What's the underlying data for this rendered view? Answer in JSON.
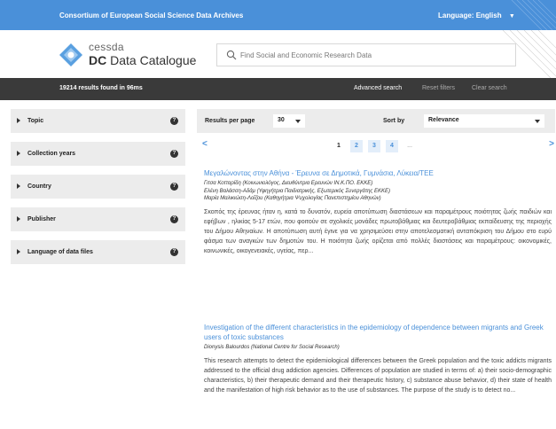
{
  "topbar": {
    "org": "Consortium of European Social Science Data Archives",
    "language_label": "Language:",
    "language_value": "English"
  },
  "logo": {
    "cessda": "cessda",
    "dc": "DC",
    "catalogue": " Data Catalogue"
  },
  "search": {
    "placeholder": "Find Social and Economic Research Data"
  },
  "resultsbar": {
    "count": "19214 results found in 96ms",
    "advanced": "Advanced search",
    "reset": "Reset filters",
    "clear": "Clear search"
  },
  "facets": [
    {
      "label": "Topic"
    },
    {
      "label": "Collection years"
    },
    {
      "label": "Country"
    },
    {
      "label": "Publisher"
    },
    {
      "label": "Language of data files"
    }
  ],
  "facet_help": "?",
  "controls": {
    "results_per_page": "Results per page",
    "rpp_value": "30",
    "sort_by": "Sort by",
    "sort_value": "Relevance"
  },
  "pager": {
    "prev": "<",
    "next": ">",
    "pages": [
      "1",
      "2",
      "3",
      "4"
    ],
    "ellipsis": "..."
  },
  "results": [
    {
      "title": "Μεγαλώνοντας στην Αθήνα - Έρευνα σε Δημοτικά, Γυμνάσια, Λύκεια/ΤΕΕ",
      "authors": [
        "Γιτσα Κοτταρίδη (Κοινωνιολόγος, Διευθύντρια Ερευνών IN.K.ΠΟ. ΕΚΚΕ)",
        "Ελένη Βαλάσση-Αδάμ (Υφηγήτρια Παιδιατρικής, Εξωτερικός Συνεργάτης ΕΚΚΕ)",
        "Μαρία Μαλικιώση-Λοΐζου (Καθηγήτρια Ψυχολογίας Πανεπιστημίου Αθηνών)"
      ],
      "abstract": "Σκοπός της έρευνας ήταν η, κατά το δυνατόν, ευρεία αποτύπωση διαστάσεων και παραμέτρους ποιότητας ζωής παιδιών και εφήβων , ηλικίας 5-17 ετών, που φοιτούν σε σχολικές μονάδες πρωτοβάθμιας και δευτεροβάθμιας εκπαίδευσης της περιοχής του Δήμου Αθηναίων. Η αποτύπωση αυτή έγινε για να χρησιμεύσει στην αποτελεσματική ανταπόκριση του Δήμου στο ευρύ φάσμα των αναγκών των δημοτών του. Η ποιότητα ζωής ορίζεται από πολλές διαστάσεις και παραμέτρους: οικονομικές, κοινωνικές, οικογενειακές, υγείας, περ..."
    },
    {
      "title": "Investigation of the different characteristics in the epidemiology of dependence between migrants and Greek users of toxic substances",
      "authors": [
        "Dionysis Balourdos (National Centre for Social Research)"
      ],
      "abstract": "This research attempts to detect the epidemiological differences between the Greek population and the toxic addicts migrants addressed to the official drug addiction agencies. Differences of population are studied in terms of: a) their socio-demographic characteristics, b) their therapeutic demand and their therapeutic history, c) substance abuse behavior, d) their state of health and the manifestation of high risk behavior as to the use of substances. The purpose of the study is to detect no..."
    }
  ]
}
